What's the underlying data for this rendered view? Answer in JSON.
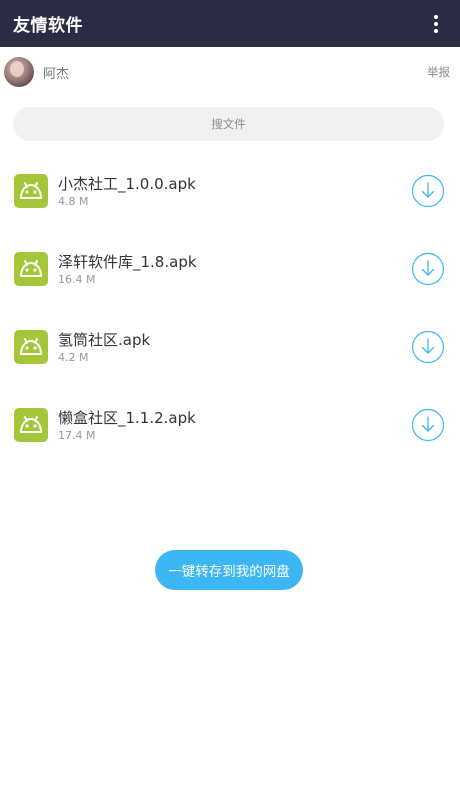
{
  "header": {
    "title": "友情软件",
    "menu_icon": "more-vertical-icon"
  },
  "user": {
    "name": "阿杰",
    "report_label": "举报",
    "avatar_icon": "avatar-image"
  },
  "search": {
    "placeholder": "搜文件"
  },
  "files": [
    {
      "name": "小杰社工_1.0.0.apk",
      "size": "4.8 M",
      "icon": "android-icon",
      "action_icon": "download-icon"
    },
    {
      "name": "泽轩软件库_1.8.apk",
      "size": "16.4 M",
      "icon": "android-icon",
      "action_icon": "download-icon"
    },
    {
      "name": "氢筒社区.apk",
      "size": "4.2 M",
      "icon": "android-icon",
      "action_icon": "download-icon"
    },
    {
      "name": "懒盒社区_1.1.2.apk",
      "size": "17.4 M",
      "icon": "android-icon",
      "action_icon": "download-icon"
    }
  ],
  "actions": {
    "save_all_label": "一键转存到我的网盘"
  },
  "colors": {
    "header_bg": "#2c2d44",
    "android_green": "#a4c639",
    "accent_blue": "#3cb7f4",
    "search_bg": "#f1f1f1"
  }
}
